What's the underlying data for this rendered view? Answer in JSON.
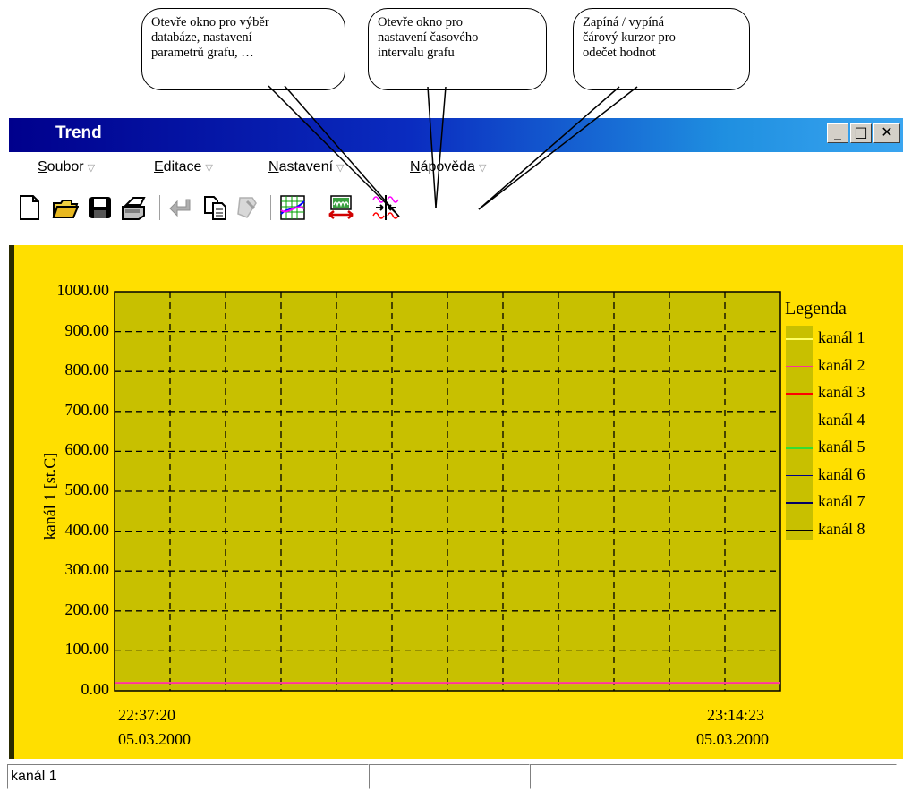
{
  "callouts": [
    {
      "lines": [
        "Otevře okno pro výběr",
        "databáze,        nastavení",
        "parametrů grafu, …"
      ]
    },
    {
      "lines": [
        "Otevře    okno    pro",
        "nastavení časového",
        "intervalu grafu"
      ]
    },
    {
      "lines": [
        "Zapíná    /    vypíná",
        "čárový kurzor pro",
        "odečet hodnot"
      ]
    }
  ],
  "window": {
    "title": "Trend",
    "buttons": {
      "minimize": "_",
      "maximize": "□",
      "close": "✕"
    }
  },
  "menu": [
    {
      "underline": "S",
      "rest": "oubor"
    },
    {
      "underline": "E",
      "rest": "ditace"
    },
    {
      "underline": "N",
      "rest": "astavení"
    },
    {
      "underline": "N",
      "rest": "ápověda"
    }
  ],
  "toolbar": {
    "icons": [
      "new-document-icon",
      "open-folder-icon",
      "save-disk-icon",
      "print-icon",
      "undo-icon",
      "copy-icon",
      "paste-icon",
      "graph-settings-icon",
      "time-interval-icon",
      "line-cursor-icon"
    ]
  },
  "colors": {
    "plot_bg": "#ffdf00",
    "grid_bg": "#c8c000",
    "accent_title": "#00008c"
  },
  "chart_data": {
    "type": "line",
    "ylabel": "kanál 1 [st.C]",
    "ylim": [
      0,
      1000
    ],
    "yticks": [
      "1000.00",
      "900.00",
      "800.00",
      "700.00",
      "600.00",
      "500.00",
      "400.00",
      "300.00",
      "200.00",
      "100.00",
      "0.00"
    ],
    "x_start": {
      "time": "22:37:20",
      "date": "05.03.2000"
    },
    "x_end": {
      "time": "23:14:23",
      "date": "05.03.2000"
    },
    "grid": true,
    "legend_title": "Legenda",
    "legend_position": "right",
    "series": [
      {
        "name": "kanál 1",
        "color": "#ffff66",
        "value": 20
      },
      {
        "name": "kanál 2",
        "color": "#ff3399",
        "value": 20
      },
      {
        "name": "kanál 3",
        "color": "#ff0000",
        "value": null
      },
      {
        "name": "kanál 4",
        "color": "#33dddd",
        "value": null
      },
      {
        "name": "kanál 5",
        "color": "#33dd33",
        "value": null
      },
      {
        "name": "kanál 6",
        "color": "#000088",
        "value": null
      },
      {
        "name": "kanál 7",
        "color": "#000066",
        "value": null
      },
      {
        "name": "kanál 8",
        "color": "#000000",
        "value": null
      }
    ]
  },
  "statusbar": {
    "cells": [
      "kanál 1",
      "",
      ""
    ]
  }
}
